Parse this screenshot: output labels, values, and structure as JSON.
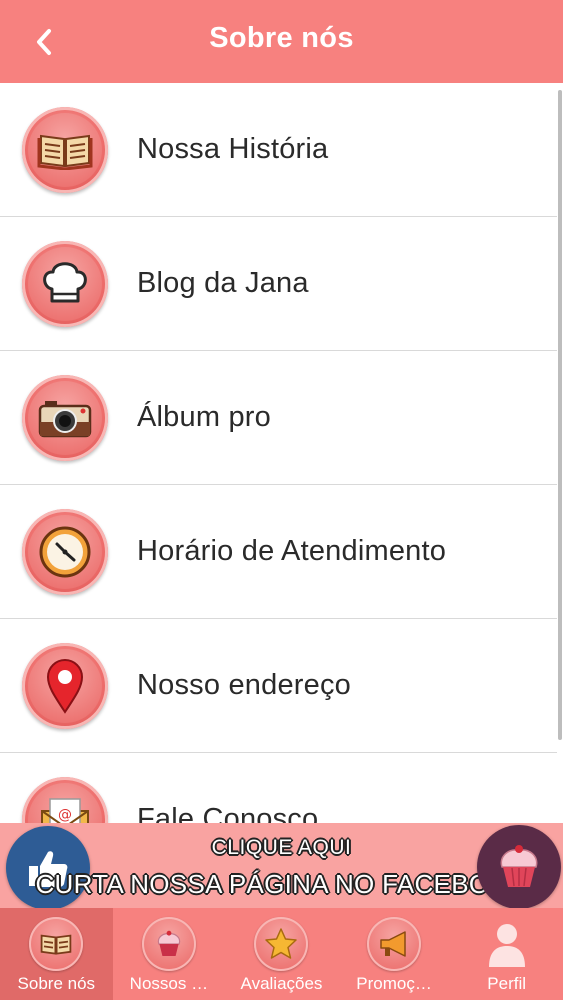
{
  "header": {
    "title": "Sobre nós",
    "back_icon": "chevron-left-icon"
  },
  "menu": {
    "items": [
      {
        "label": "Nossa História",
        "icon": "book-icon"
      },
      {
        "label": "Blog da Jana",
        "icon": "chef-hat-icon"
      },
      {
        "label": "Álbum pro",
        "icon": "camera-icon"
      },
      {
        "label": "Horário de Atendimento",
        "icon": "clock-icon"
      },
      {
        "label": "Nosso endereço",
        "icon": "map-pin-icon"
      },
      {
        "label": "Fale Conosco",
        "icon": "envelope-icon"
      }
    ]
  },
  "facebook_banner": {
    "line1": "CLIQUE AQUI",
    "line2": "CURTA NOSSA PÁGINA NO FACEBOOK"
  },
  "tabbar": {
    "tabs": [
      {
        "label": "Sobre nós",
        "icon": "book-icon",
        "active": true
      },
      {
        "label": "Nossos …",
        "icon": "cupcake-icon",
        "active": false
      },
      {
        "label": "Avaliações",
        "icon": "star-icon",
        "active": false
      },
      {
        "label": "Promoç…",
        "icon": "megaphone-icon",
        "active": false
      },
      {
        "label": "Perfil",
        "icon": "user-icon",
        "active": false
      }
    ]
  },
  "colors": {
    "accent": "#f7817f",
    "active_tab": "#e06a68",
    "banner": "#f9a3a1"
  }
}
